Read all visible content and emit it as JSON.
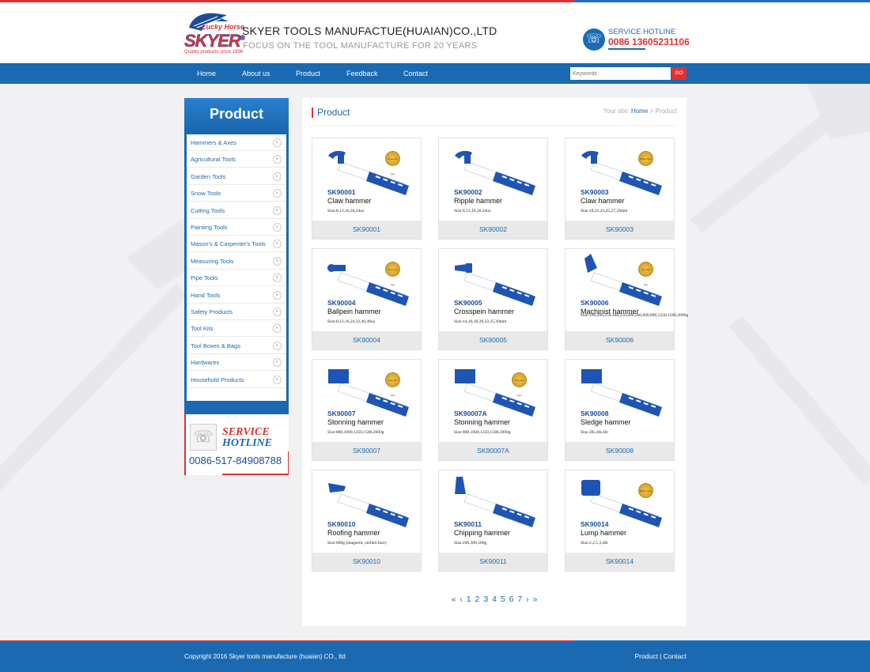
{
  "header": {
    "logo_top": "Lucky Horse",
    "logo_brand": "SKYER",
    "logo_reg": "®",
    "logo_tagline": "Quality products since 1996",
    "company": "SKYER TOOLS MANUFACTUE(HUAIAN)CO.,LTD",
    "slogan": "FOCUS ON THE TOOL MANUFACTURE FOR 20 YEARS",
    "hotline_label": "SERVICE HOTLINE",
    "hotline_number": "0086 13605231106"
  },
  "nav": {
    "items": [
      "Home",
      "About us",
      "Product",
      "Feedback",
      "Contact"
    ],
    "search_placeholder": "Keywords",
    "go_label": "GO"
  },
  "sidebar": {
    "title": "Product",
    "items": [
      "Hammers & Axes",
      "Agricultural Tools",
      "Garden Tools",
      "Snow Tools",
      "Cutting Tools",
      "Painting Tools",
      "Mason's & Carpenter's Tools",
      "Measuring Tools",
      "Pipe Tools",
      "Hand Tools",
      "Safety Products",
      "Tool Kits",
      "Tool Boxes & Bags",
      "Hardwares",
      "Household Products"
    ],
    "hotline_service": "SERVICE",
    "hotline_word": "HOTLINE",
    "hotline_number": "0086-517-84908788"
  },
  "main": {
    "title": "Product",
    "crumb_prefix": "Your site:",
    "crumb_home": "Home",
    "crumb_sep": ">",
    "crumb_current": "Product"
  },
  "products": [
    {
      "code": "SK90001",
      "name": "Claw hammer",
      "size": "Size:8,13,16,20,24oz",
      "seal": "American type",
      "head": "claw"
    },
    {
      "code": "SK90002",
      "name": "Ripple hammer",
      "size": "Size:8,13,16,20,24oz",
      "seal": "",
      "head": "claw"
    },
    {
      "code": "SK90003",
      "name": "Claw hammer",
      "size": "Size:18,21,23,25,27,29mm",
      "seal": "British type",
      "head": "claw"
    },
    {
      "code": "SK90004",
      "name": "Ballpein hammer",
      "size": "Size:8,12,16,24,32,40,48oz",
      "seal": "American type",
      "head": "ball"
    },
    {
      "code": "SK90005",
      "name": "Crosspein hammer",
      "size": "Size:14,16,18,20,22,25,30mm",
      "seal": "",
      "head": "cross"
    },
    {
      "code": "SK90006",
      "name": "Machinist hammer",
      "size": "Size:100,200,250,300,250,400,500,600,800,1250,1500,2000g",
      "seal": "German type",
      "head": "machinist"
    },
    {
      "code": "SK90007",
      "name": "Stonning hammer",
      "size": "Size:800,1000,1250,1500,2000g",
      "seal": "German type",
      "head": "sledge"
    },
    {
      "code": "SK90007A",
      "name": "Stonning hammer",
      "size": "Size:800,1000,1250,1500,2000g",
      "seal": "German type",
      "head": "sledge"
    },
    {
      "code": "SK90008",
      "name": "Sledge hammer",
      "size": "Size:2lb,3lb,4lb",
      "seal": "",
      "head": "sledge"
    },
    {
      "code": "SK90010",
      "name": "Roofing hammer",
      "size": "Size:600g (magnetic ,milled face)",
      "seal": "",
      "head": "roofing"
    },
    {
      "code": "SK90011",
      "name": "Chipping hammer",
      "size": "Size:200,300,500g",
      "seal": "",
      "head": "chipping"
    },
    {
      "code": "SK90014",
      "name": "Lump hammer",
      "size": "Size:2,2.5,3,4lb",
      "seal": "British type",
      "head": "lump"
    }
  ],
  "pager": {
    "first": "«",
    "prev": "‹",
    "pages": [
      "1",
      "2",
      "3",
      "4",
      "5",
      "6",
      "7"
    ],
    "next": "›",
    "last": "»"
  },
  "footer": {
    "copyright": "Copyright 2016 Skyer tools manufacture (huaian) CO., ltd",
    "link_product": "Product",
    "separator": "|",
    "link_contact": "Contact"
  },
  "colors": {
    "brand_blue": "#1a69b1",
    "accent_red": "#e03131"
  },
  "icons": {
    "hotline": "phone-icon",
    "sidebar_arrow": "circle-arrow-icon"
  }
}
